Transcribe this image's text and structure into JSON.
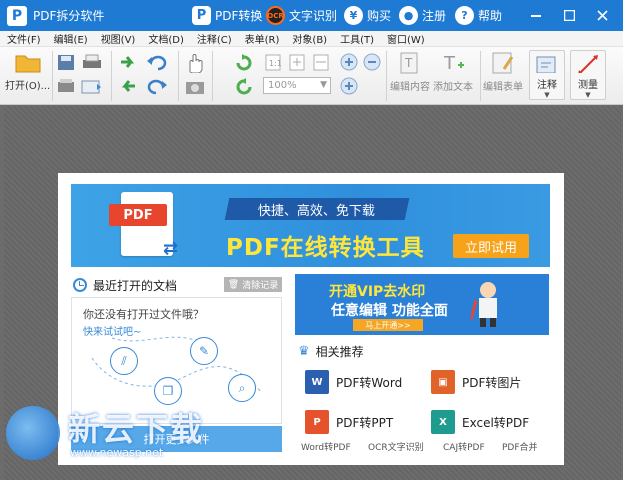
{
  "titlebar": {
    "app_title": "PDF拆分软件",
    "pdf_convert": "PDF转换",
    "ocr": "文字识别",
    "buy": "购买",
    "register": "注册",
    "help": "帮助",
    "ocr_badge": "OCR",
    "brand_color": "#1e7ad3"
  },
  "menubar": {
    "items": [
      "文件(F)",
      "编辑(E)",
      "视图(V)",
      "文档(D)",
      "注释(C)",
      "表单(R)",
      "对象(B)",
      "工具(T)",
      "窗口(W)"
    ]
  },
  "toolbar": {
    "open_label": "打开(O)...",
    "zoom_value": "100%",
    "edit_content": "编辑内容",
    "add_text": "添加文本",
    "edit_form": "编辑表单",
    "annotate": "注释",
    "measure": "测量"
  },
  "banner": {
    "pdf_tag": "PDF",
    "tagline": "快捷、高效、免下载",
    "headline": "PDF在线转换工具",
    "cta": "立即试用"
  },
  "recent": {
    "title": "最近打开的文档",
    "clear": "清除记录",
    "empty_text": "你还没有打开过文件哦？",
    "try_link": "快来试试吧~",
    "open_btn": "打开更多文件"
  },
  "vip": {
    "line1": "开通VIP去水印",
    "line2": "任意编辑  功能全面",
    "button": "马上开通>>"
  },
  "recommend": {
    "title": "相关推荐",
    "items": [
      "PDF转Word",
      "PDF转图片",
      "PDF转PPT",
      "Excel转PDF"
    ],
    "footer": [
      "Word转PDF",
      "OCR文字识别",
      "CAJ转PDF",
      "PDF合并"
    ]
  },
  "watermark": {
    "text": "新云下载",
    "url": "www.newasp.net"
  }
}
